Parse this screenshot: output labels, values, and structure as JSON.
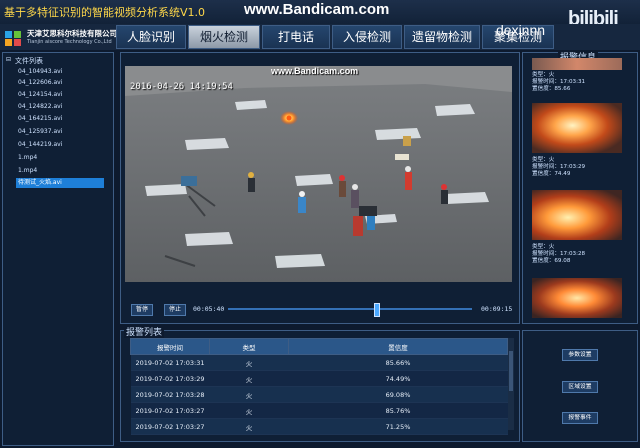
{
  "app": {
    "title": "基于多特征识别的智能视频分析系统V1.0",
    "watermark": "www.Bandicam.com",
    "uploader": "dexinnn",
    "site_logo": "bilibili"
  },
  "company": {
    "name": "天津艾思科尔科技有限公司",
    "english": "Tianjin aiscore Technology Co.,Ltd"
  },
  "tabs": [
    {
      "label": "人脸识别"
    },
    {
      "label": "烟火检测"
    },
    {
      "label": "打电话"
    },
    {
      "label": "入侵检测"
    },
    {
      "label": "遗留物检测"
    },
    {
      "label": "聚集检测"
    }
  ],
  "file_list": {
    "title": "文件列表",
    "items": [
      {
        "name": "04_104943.avi"
      },
      {
        "name": "04_122606.avi"
      },
      {
        "name": "04_124154.avi"
      },
      {
        "name": "04_124822.avi"
      },
      {
        "name": "04_164215.avi"
      },
      {
        "name": "04_125937.avi"
      },
      {
        "name": "04_144219.avi"
      },
      {
        "name": "1.mp4"
      },
      {
        "name": "1.mp4"
      },
      {
        "name": "待测试_火焰.avi"
      }
    ],
    "selected_index": 9
  },
  "video": {
    "timestamp": "2016-04-26 14:19:54",
    "watermark": "www.Bandicam.com"
  },
  "player": {
    "pause_label": "暂停",
    "stop_label": "停止",
    "current_time": "00:05:40",
    "total_time": "00:09:15",
    "progress_fraction": 0.61
  },
  "alarm_list": {
    "title": "报警列表",
    "columns": [
      "报警时间",
      "类型",
      "置信度"
    ],
    "rows": [
      {
        "time": "2019-07-02 17:03:31",
        "type": "火",
        "confidence": "85.66%"
      },
      {
        "time": "2019-07-02 17:03:29",
        "type": "火",
        "confidence": "74.49%"
      },
      {
        "time": "2019-07-02 17:03:28",
        "type": "火",
        "confidence": "69.08%"
      },
      {
        "time": "2019-07-02 17:03:27",
        "type": "火",
        "confidence": "85.76%"
      },
      {
        "time": "2019-07-02 17:03:27",
        "type": "火",
        "confidence": "71.25%"
      }
    ]
  },
  "alarm_info": {
    "title": "报警信息",
    "cards": [
      {
        "type": "类型：火",
        "time": "报警时间：17:03:31",
        "confidence": "置信度：85.66"
      },
      {
        "type": "类型：火",
        "time": "报警时间：17:03:29",
        "confidence": "置信度：74.49"
      },
      {
        "type": "类型：火",
        "time": "报警时间：17:03:28",
        "confidence": "置信度：69.08"
      }
    ]
  },
  "side_buttons": {
    "params": "参数设置",
    "region": "区域设置",
    "events": "报警事件"
  },
  "colors": {
    "background": "#0d1a2e",
    "accent": "#1e7fd8",
    "title_text": "#ffd84a",
    "fire": "#ff7a1a"
  }
}
